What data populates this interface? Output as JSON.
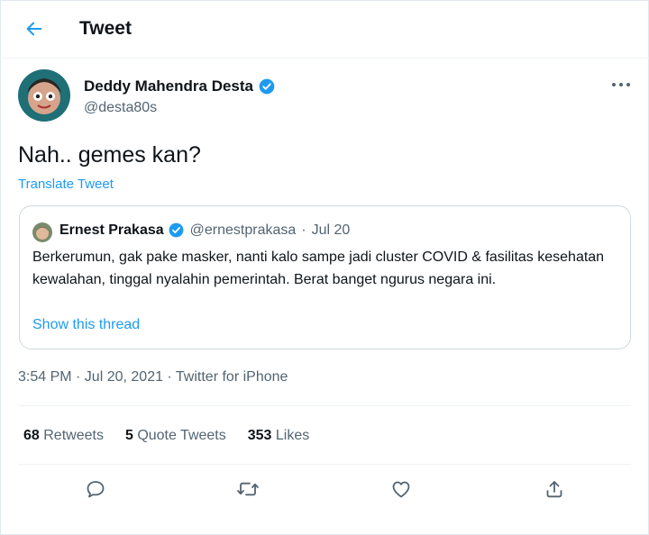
{
  "header": {
    "title": "Tweet"
  },
  "author": {
    "name": "Deddy Mahendra Desta",
    "handle": "@desta80s"
  },
  "tweet": {
    "text": "Nah.. gemes kan?",
    "translate_label": "Translate Tweet"
  },
  "quote": {
    "name": "Ernest Prakasa",
    "handle": "@ernestprakasa",
    "separator": "·",
    "date": "Jul 20",
    "text": "Berkerumun, gak pake masker, nanti kalo sampe jadi cluster COVID & fasilitas kesehatan kewalahan, tinggal nyalahin pemerintah. Berat banget ngurus negara ini.",
    "show_thread": "Show this thread"
  },
  "meta": "3:54 PM · Jul 20, 2021 · Twitter for iPhone",
  "stats": {
    "retweets": {
      "count": "68",
      "label": "Retweets"
    },
    "quotes": {
      "count": "5",
      "label": "Quote Tweets"
    },
    "likes": {
      "count": "353",
      "label": "Likes"
    }
  },
  "colors": {
    "accent": "#1d9bf0",
    "text": "#0f1419",
    "muted": "#536471",
    "border": "#cfd9de"
  },
  "icons": [
    "back-arrow-icon",
    "verified-badge-icon",
    "more-icon",
    "reply-icon",
    "retweet-icon",
    "like-icon",
    "share-icon"
  ]
}
